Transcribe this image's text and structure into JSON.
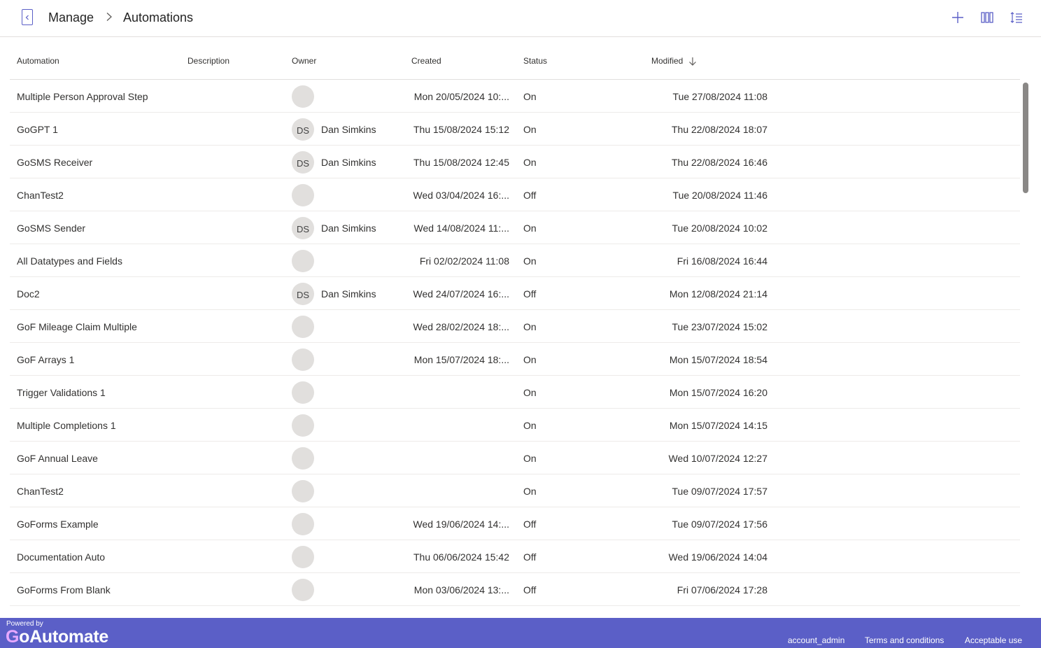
{
  "header": {
    "breadcrumb": [
      "Manage",
      "Automations"
    ],
    "icons": {
      "back": "back-icon",
      "add": "add-icon",
      "columns": "columns-icon",
      "sort": "sort-icon"
    }
  },
  "table": {
    "columns": [
      "Automation",
      "Description",
      "Owner",
      "Created",
      "Status",
      "Modified"
    ],
    "sort_icon": "arrow-down-icon",
    "rows": [
      {
        "name": "Multiple Person Approval Step",
        "initials": "",
        "owner": "",
        "created": "Mon 20/05/2024 10:...",
        "status": "On",
        "modified": "Tue 27/08/2024 11:08"
      },
      {
        "name": "GoGPT 1",
        "initials": "DS",
        "owner": "Dan Simkins",
        "created": "Thu 15/08/2024 15:12",
        "status": "On",
        "modified": "Thu 22/08/2024 18:07"
      },
      {
        "name": "GoSMS Receiver",
        "initials": "DS",
        "owner": "Dan Simkins",
        "created": "Thu 15/08/2024 12:45",
        "status": "On",
        "modified": "Thu 22/08/2024 16:46"
      },
      {
        "name": "ChanTest2",
        "initials": "",
        "owner": "",
        "created": "Wed 03/04/2024 16:...",
        "status": "Off",
        "modified": "Tue 20/08/2024 11:46"
      },
      {
        "name": "GoSMS Sender",
        "initials": "DS",
        "owner": "Dan Simkins",
        "created": "Wed 14/08/2024 11:...",
        "status": "On",
        "modified": "Tue 20/08/2024 10:02"
      },
      {
        "name": "All Datatypes and Fields",
        "initials": "",
        "owner": "",
        "created": "Fri 02/02/2024 11:08",
        "status": "On",
        "modified": "Fri 16/08/2024 16:44"
      },
      {
        "name": "Doc2",
        "initials": "DS",
        "owner": "Dan Simkins",
        "created": "Wed 24/07/2024 16:...",
        "status": "Off",
        "modified": "Mon 12/08/2024 21:14"
      },
      {
        "name": "GoF Mileage Claim Multiple",
        "initials": "",
        "owner": "",
        "created": "Wed 28/02/2024 18:...",
        "status": "On",
        "modified": "Tue 23/07/2024 15:02"
      },
      {
        "name": "GoF Arrays 1",
        "initials": "",
        "owner": "",
        "created": "Mon 15/07/2024 18:...",
        "status": "On",
        "modified": "Mon 15/07/2024 18:54"
      },
      {
        "name": "Trigger Validations 1",
        "initials": "",
        "owner": "",
        "created": "",
        "status": "On",
        "modified": "Mon 15/07/2024 16:20"
      },
      {
        "name": "Multiple Completions 1",
        "initials": "",
        "owner": "",
        "created": "",
        "status": "On",
        "modified": "Mon 15/07/2024 14:15"
      },
      {
        "name": "GoF Annual Leave",
        "initials": "",
        "owner": "",
        "created": "",
        "status": "On",
        "modified": "Wed 10/07/2024 12:27"
      },
      {
        "name": "ChanTest2",
        "initials": "",
        "owner": "",
        "created": "",
        "status": "On",
        "modified": "Tue 09/07/2024 17:57"
      },
      {
        "name": "GoForms Example",
        "initials": "",
        "owner": "",
        "created": "Wed 19/06/2024 14:...",
        "status": "Off",
        "modified": "Tue 09/07/2024 17:56"
      },
      {
        "name": "Documentation Auto",
        "initials": "",
        "owner": "",
        "created": "Thu 06/06/2024 15:42",
        "status": "Off",
        "modified": "Wed 19/06/2024 14:04"
      },
      {
        "name": "GoForms From Blank",
        "initials": "",
        "owner": "",
        "created": "Mon 03/06/2024 13:...",
        "status": "Off",
        "modified": "Fri 07/06/2024 17:28"
      }
    ]
  },
  "footer": {
    "powered_by": "Powered by",
    "brand_g": "G",
    "brand_rest": "oAutomate",
    "links": [
      "account_admin",
      "Terms and conditions",
      "Acceptable use"
    ]
  },
  "colors": {
    "accent": "#5b5fc7",
    "avatar_bg": "#e1dfdd",
    "footer_bg": "#5b5fc7"
  }
}
